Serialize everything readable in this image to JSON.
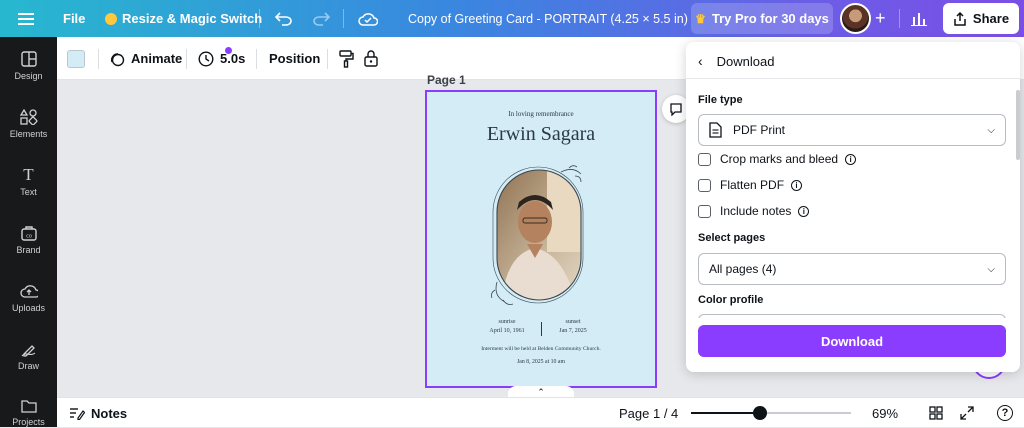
{
  "topbar": {
    "menu_icon": "hamburger-icon",
    "file_label": "File",
    "resize_label": "Resize & Magic Switch",
    "doc_title": "Copy of  Greeting Card - PORTRAIT (4.25 × 5.5 in)",
    "pro_label": "Try Pro for 30 days",
    "share_label": "Share"
  },
  "sidebar": {
    "items": [
      {
        "label": "Design",
        "icon": "design-icon"
      },
      {
        "label": "Elements",
        "icon": "elements-icon"
      },
      {
        "label": "Text",
        "icon": "text-icon"
      },
      {
        "label": "Brand",
        "icon": "brand-icon"
      },
      {
        "label": "Uploads",
        "icon": "uploads-icon"
      },
      {
        "label": "Draw",
        "icon": "draw-icon"
      },
      {
        "label": "Projects",
        "icon": "projects-icon"
      }
    ]
  },
  "toolbar": {
    "animate_label": "Animate",
    "duration_label": "5.0s",
    "position_label": "Position",
    "swatch_color": "#d3ecf5"
  },
  "canvas": {
    "page_label": "Page 1",
    "card": {
      "subtitle": "In loving remembrance",
      "name": "Erwin Sagara",
      "sunrise_label": "sunrise",
      "sunrise_date": "April 10, 1961",
      "sunset_label": "sunset",
      "sunset_date": "Jan 7, 2025",
      "interment": "Interment will be held at Belden Community Church.",
      "datetime": "Jan 8, 2025 at 10 am"
    }
  },
  "bottombar": {
    "notes_label": "Notes",
    "page_indicator": "Page 1 / 4",
    "zoom": "69%",
    "zoom_fraction": 0.69
  },
  "download_panel": {
    "title": "Download",
    "file_type_label": "File type",
    "file_type_value": "PDF Print",
    "options": [
      {
        "label": "Crop marks and bleed",
        "checked": false
      },
      {
        "label": "Flatten PDF",
        "checked": false
      },
      {
        "label": "Include notes",
        "checked": false
      }
    ],
    "select_pages_label": "Select pages",
    "select_pages_value": "All pages (4)",
    "color_profile_label": "Color profile",
    "download_button": "Download"
  },
  "colors": {
    "accent": "#8b3dff",
    "card_bg": "#d3ecf5",
    "sidebar_bg": "#18191b"
  }
}
